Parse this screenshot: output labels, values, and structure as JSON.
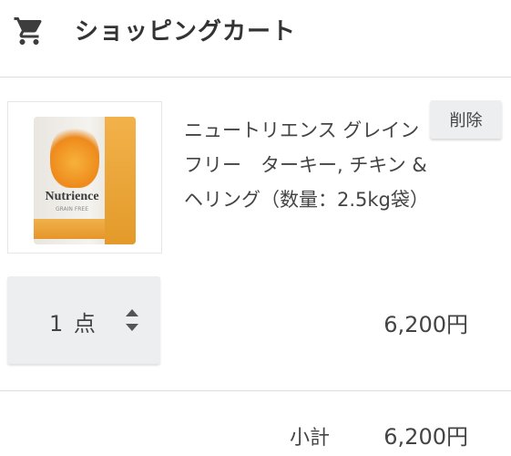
{
  "header": {
    "title": "ショッピングカート",
    "icon": "shopping-cart-icon"
  },
  "cart": {
    "items": [
      {
        "name": "ニュートリエンス グレインフリー　ターキー, チキン & ヘリング（数量：2.5kg袋）",
        "delete_label": "削除",
        "quantity_label": "1 点",
        "price": "6,200円",
        "image_brand": "Nutrience",
        "image_subbrand": "GRAIN FREE"
      }
    ],
    "subtotal_label": "小計",
    "subtotal_value": "6,200円"
  },
  "colors": {
    "button_bg": "#eceeef",
    "text": "#444444",
    "divider": "#dcdcdc"
  }
}
